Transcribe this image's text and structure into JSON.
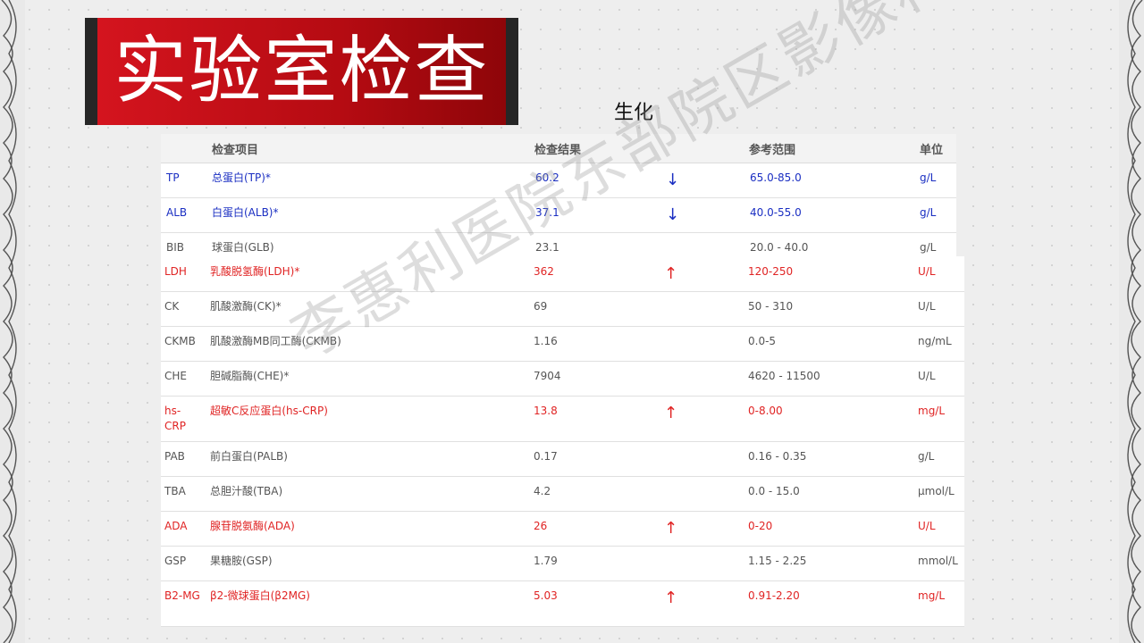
{
  "slide": {
    "title": "实验室检查",
    "subtitle": "生化",
    "watermark": "李惠利医院东部院区影像科"
  },
  "table": {
    "headers": {
      "item": "检查项目",
      "result": "检查结果",
      "range": "参考范围",
      "unit": "单位"
    },
    "top_rows": [
      {
        "code": "TP",
        "name": "总蛋白(TP)*",
        "result": "60.2",
        "flag": "↓",
        "range": "65.0-85.0",
        "unit": "g/L",
        "style": "blue"
      },
      {
        "code": "ALB",
        "name": "白蛋白(ALB)*",
        "result": "37.1",
        "flag": "↓",
        "range": "40.0-55.0",
        "unit": "g/L",
        "style": "blue"
      },
      {
        "code": "BIB",
        "name": "球蛋白(GLB)",
        "result": "23.1",
        "flag": "",
        "range": "20.0 - 40.0",
        "unit": "g/L",
        "style": "normal"
      }
    ],
    "rows": [
      {
        "code": "LDH",
        "name": "乳酸脱氢酶(LDH)*",
        "result": "362",
        "flag": "↑",
        "range": "120-250",
        "unit": "U/L",
        "style": "red"
      },
      {
        "code": "CK",
        "name": "肌酸激酶(CK)*",
        "result": "69",
        "flag": "",
        "range": "50 - 310",
        "unit": "U/L",
        "style": "normal"
      },
      {
        "code": "CKMB",
        "name": "肌酸激酶MB同工酶(CKMB)",
        "result": "1.16",
        "flag": "",
        "range": "0.0-5",
        "unit": "ng/mL",
        "style": "normal"
      },
      {
        "code": "CHE",
        "name": "胆碱脂酶(CHE)*",
        "result": "7904",
        "flag": "",
        "range": "4620 - 11500",
        "unit": "U/L",
        "style": "normal"
      },
      {
        "code": "hs-CRP",
        "name": "超敏C反应蛋白(hs-CRP)",
        "result": "13.8",
        "flag": "↑",
        "range": "0-8.00",
        "unit": "mg/L",
        "style": "red"
      },
      {
        "code": "PAB",
        "name": "前白蛋白(PALB)",
        "result": "0.17",
        "flag": "",
        "range": "0.16 - 0.35",
        "unit": "g/L",
        "style": "normal"
      },
      {
        "code": "TBA",
        "name": "总胆汁酸(TBA)",
        "result": "4.2",
        "flag": "",
        "range": "0.0 - 15.0",
        "unit": "μmol/L",
        "style": "normal"
      },
      {
        "code": "ADA",
        "name": "腺苷脱氨酶(ADA)",
        "result": "26",
        "flag": "↑",
        "range": "0-20",
        "unit": "U/L",
        "style": "red"
      },
      {
        "code": "GSP",
        "name": "果糖胺(GSP)",
        "result": "1.79",
        "flag": "",
        "range": "1.15 - 2.25",
        "unit": "mmol/L",
        "style": "normal"
      },
      {
        "code": "B2-MG",
        "name": "β2-微球蛋白(β2MG)",
        "result": "5.03",
        "flag": "↑",
        "range": "0.91-2.20",
        "unit": "mg/L",
        "style": "red"
      }
    ]
  },
  "colors": {
    "abnormal_low": "#1a2ec2",
    "abnormal_high": "#e02424",
    "title_red": "#c8101a"
  }
}
